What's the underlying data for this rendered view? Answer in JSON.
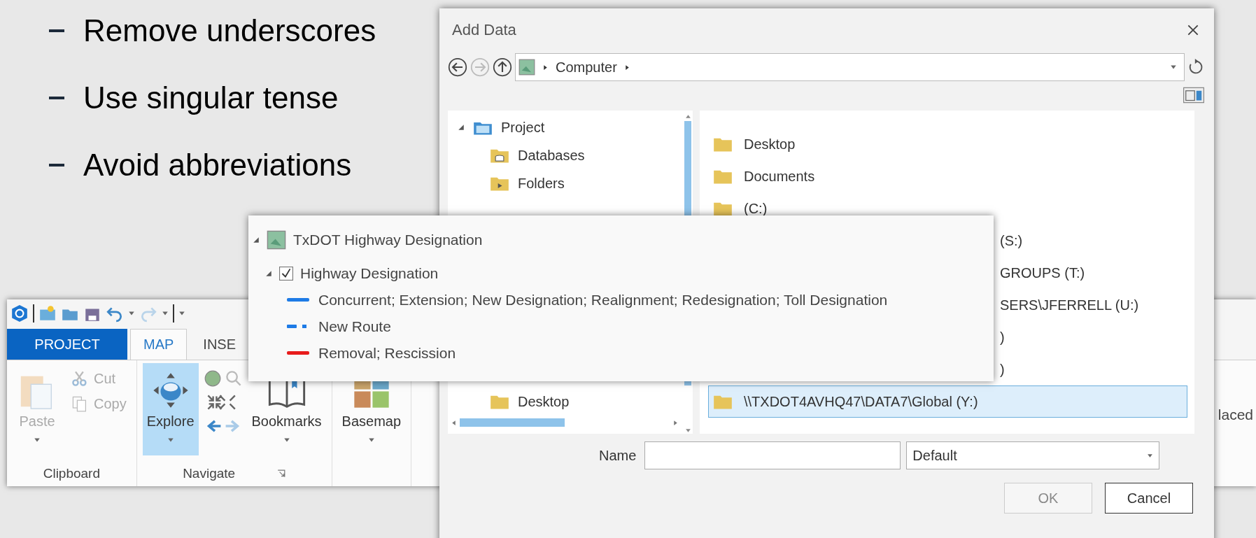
{
  "bullets": [
    "Remove underscores",
    "Use singular tense",
    "Avoid abbreviations"
  ],
  "ribbon": {
    "tabs": [
      {
        "label": "PROJECT",
        "kind": "backstage",
        "selected": false
      },
      {
        "label": "MAP",
        "kind": "tab",
        "selected": true
      },
      {
        "label": "INSE",
        "kind": "tab",
        "selected": false
      }
    ],
    "groups": [
      {
        "label": "Clipboard",
        "tools": [
          {
            "label": "Paste",
            "kind": "large",
            "disabled": true,
            "selected": false
          },
          {
            "label": "Cut",
            "kind": "small",
            "disabled": true,
            "selected": false
          },
          {
            "label": "Copy",
            "kind": "small",
            "disabled": true,
            "selected": false
          }
        ]
      },
      {
        "label": "Navigate",
        "tools": [
          {
            "label": "Explore",
            "kind": "large",
            "disabled": false,
            "selected": true
          },
          {
            "label": "Bookmarks",
            "kind": "large",
            "disabled": false,
            "selected": false
          }
        ]
      },
      {
        "tools": [
          {
            "label": "Basemap",
            "kind": "large",
            "disabled": false,
            "selected": false
          }
        ]
      }
    ],
    "clipped_text": "laced"
  },
  "dialog": {
    "title": "Add Data",
    "breadcrumb": [
      "Computer"
    ],
    "tree": [
      {
        "label": "Project",
        "expanded": true,
        "children": [
          {
            "label": "Databases",
            "kind": "database"
          },
          {
            "label": "Folders",
            "kind": "folder"
          }
        ]
      }
    ],
    "tree_tail": [
      {
        "label": "Desktop"
      }
    ],
    "items": [
      {
        "label": "Desktop",
        "kind": "full",
        "selected": false
      },
      {
        "label": "Documents",
        "kind": "full",
        "selected": false
      },
      {
        "label": "(C:)",
        "kind": "full",
        "selected": false
      },
      {
        "label": "(S:)",
        "kind": "part",
        "selected": false
      },
      {
        "label": "GROUPS (T:)",
        "kind": "part",
        "selected": false
      },
      {
        "label": "SERS\\JFERRELL (U:)",
        "kind": "part",
        "selected": false
      },
      {
        "label": ")",
        "kind": "part",
        "selected": false
      },
      {
        "label": ")",
        "kind": "part",
        "selected": false
      },
      {
        "label": "\\\\TXDOT4AVHQ47\\DATA7\\Global (Y:)",
        "kind": "full",
        "selected": true
      }
    ],
    "name_label": "Name",
    "type_value": "Default",
    "buttons": [
      {
        "label": "OK",
        "disabled": true
      },
      {
        "label": "Cancel",
        "disabled": false
      }
    ]
  },
  "legend": {
    "map": {
      "label": "TxDOT Highway Designation",
      "expanded": true
    },
    "layer": {
      "label": "Highway Designation",
      "checked": true,
      "expanded": true
    },
    "entries": [
      {
        "label": "Concurrent; Extension; New Designation; Realignment; Redesignation; Toll Designation",
        "kind": "solid",
        "color": "#1e7be6"
      },
      {
        "label": "New Route",
        "kind": "dashdot",
        "color": "#1e7be6"
      },
      {
        "label": "Removal; Rescission",
        "kind": "solid",
        "color": "#e81c1c"
      }
    ]
  }
}
